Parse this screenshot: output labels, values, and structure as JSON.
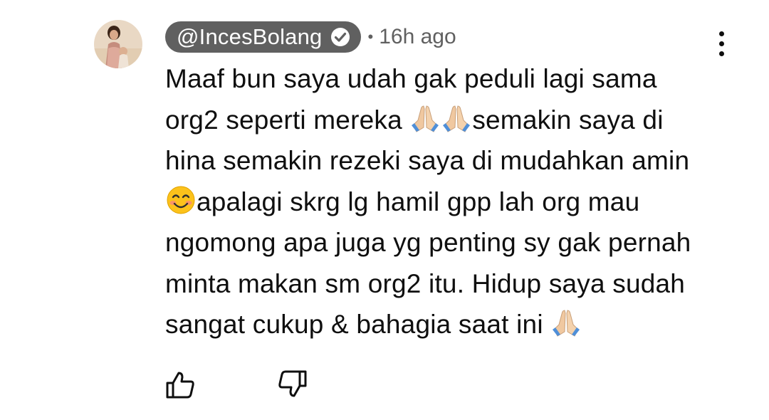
{
  "comment": {
    "handle": "@IncesBolang",
    "verified": true,
    "separator": "•",
    "timestamp": "16h ago",
    "lines": [
      [
        "Maaf bun saya udah gak peduli lagi sama"
      ],
      [
        "org2 seperti mereka ",
        "folded-hands-emoji",
        "folded-hands-emoji",
        "semakin saya di"
      ],
      [
        "hina semakin rezeki saya di mudahkan amin"
      ],
      [
        "smiling-face-emoji",
        "apalagi skrg lg hamil gpp lah org mau"
      ],
      [
        "ngomong apa juga yg penting sy gak pernah"
      ],
      [
        "minta makan sm org2 itu. Hidup saya sudah"
      ],
      [
        "sangat cukup & bahagia saat ini ",
        "folded-hands-emoji"
      ]
    ]
  },
  "actions": {
    "like_icon": "thumbs-up-icon",
    "dislike_icon": "thumbs-down-icon",
    "menu_icon": "more-vertical-icon"
  },
  "colors": {
    "chip_bg": "#606060",
    "meta_text": "#606060",
    "text": "#0f0f0f",
    "background": "#ffffff"
  }
}
